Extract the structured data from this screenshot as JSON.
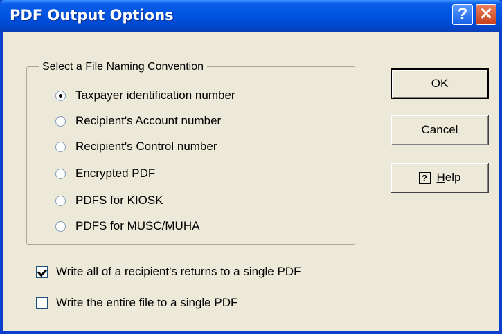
{
  "window": {
    "title": "PDF Output Options",
    "help_glyph": "?",
    "close_glyph": "✕"
  },
  "group": {
    "legend": "Select a File Naming Convention",
    "options": [
      {
        "label": "Taxpayer identification number",
        "selected": true
      },
      {
        "label": "Recipient's Account number",
        "selected": false
      },
      {
        "label": "Recipient's Control number",
        "selected": false
      },
      {
        "label": "Encrypted PDF",
        "selected": false
      },
      {
        "label": "PDFS for KIOSK",
        "selected": false
      },
      {
        "label": "PDFS for MUSC/MUHA",
        "selected": false
      }
    ]
  },
  "checkboxes": [
    {
      "label": "Write all of a recipient's returns to a single PDF",
      "checked": true
    },
    {
      "label": "Write the entire file to a single PDF",
      "checked": false
    }
  ],
  "buttons": {
    "ok": "OK",
    "cancel": "Cancel",
    "help_icon": "?",
    "help_first": "H",
    "help_rest": "elp"
  },
  "colors": {
    "titlebar": "#0054e3",
    "dialog_bg": "#ece9d8",
    "close_button": "#c8401a"
  }
}
